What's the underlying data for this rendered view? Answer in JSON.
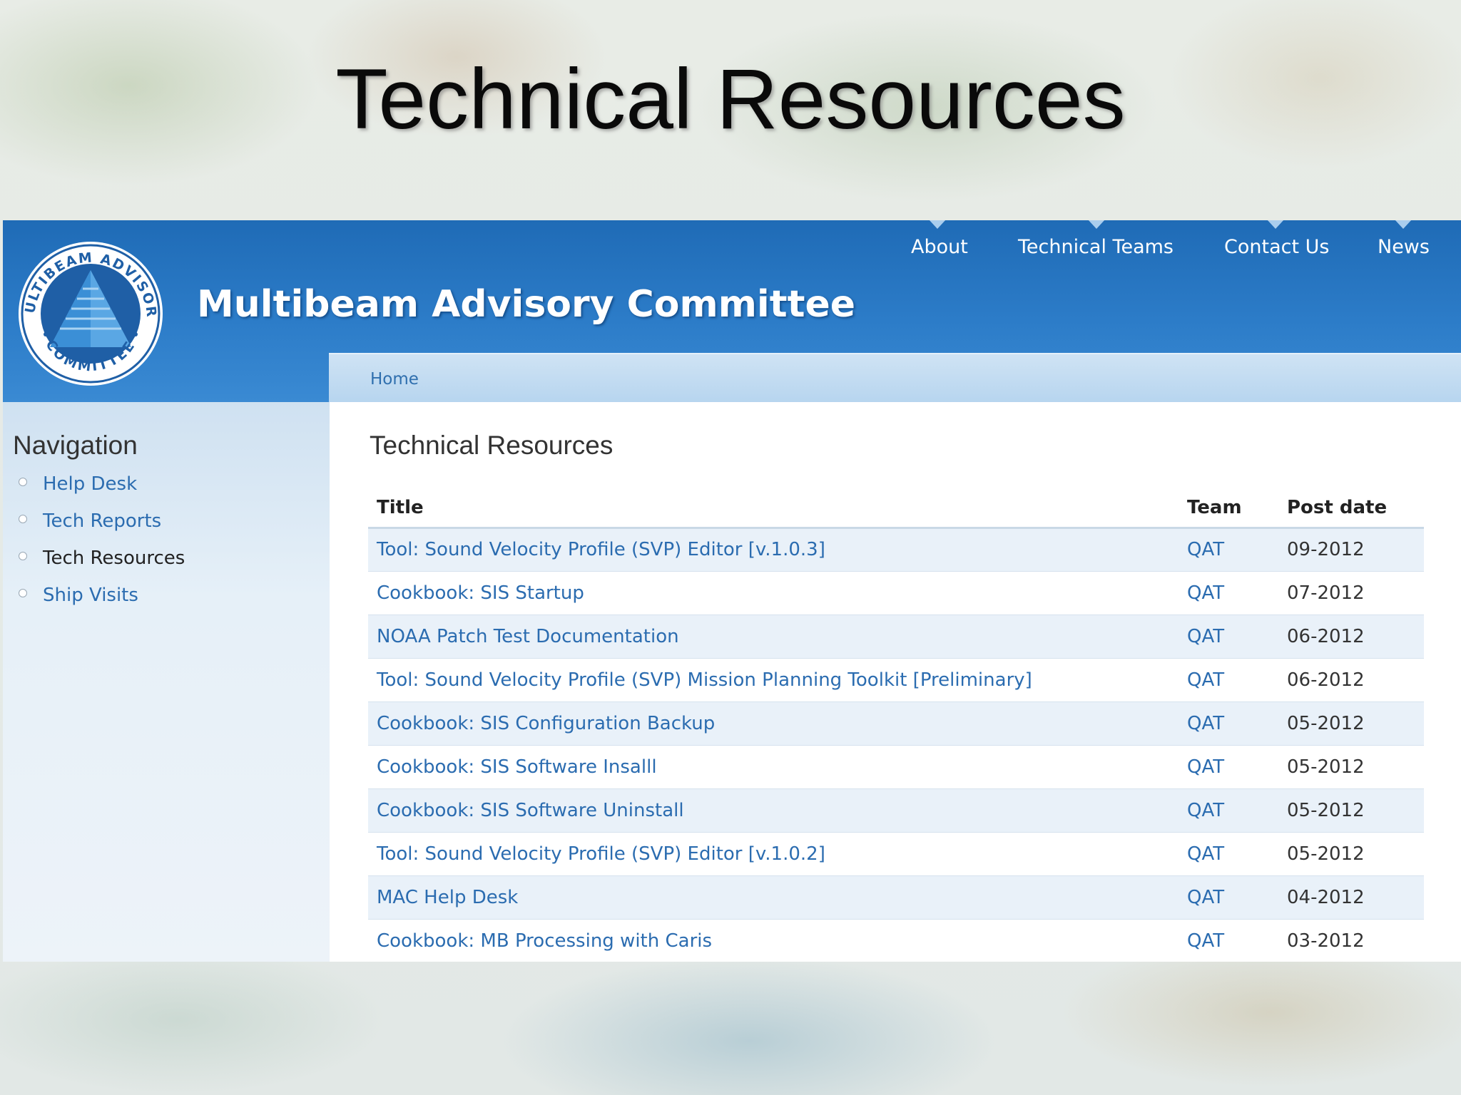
{
  "slide": {
    "title": "Technical Resources"
  },
  "site": {
    "name": "Multibeam Advisory Committee",
    "logo_text": "MULTIBEAM ADVISORY COMMITTEE",
    "top_nav": [
      "About",
      "Technical Teams",
      "Contact Us",
      "News"
    ],
    "breadcrumb": "Home"
  },
  "sidebar": {
    "heading": "Navigation",
    "items": [
      {
        "label": "Help Desk",
        "active": false
      },
      {
        "label": "Tech Reports",
        "active": false
      },
      {
        "label": "Tech Resources",
        "active": true
      },
      {
        "label": "Ship Visits",
        "active": false
      }
    ]
  },
  "main": {
    "title": "Technical Resources",
    "columns": [
      "Title",
      "Team",
      "Post date"
    ],
    "rows": [
      {
        "title": "Tool: Sound Velocity Profile (SVP) Editor [v.1.0.3]",
        "team": "QAT",
        "date": "09-2012"
      },
      {
        "title": "Cookbook: SIS Startup",
        "team": "QAT",
        "date": "07-2012"
      },
      {
        "title": "NOAA Patch Test Documentation",
        "team": "QAT",
        "date": "06-2012"
      },
      {
        "title": "Tool: Sound Velocity Profile (SVP) Mission Planning Toolkit [Preliminary]",
        "team": "QAT",
        "date": "06-2012"
      },
      {
        "title": "Cookbook: SIS Configuration Backup",
        "team": "QAT",
        "date": "05-2012"
      },
      {
        "title": "Cookbook: SIS Software Insalll",
        "team": "QAT",
        "date": "05-2012"
      },
      {
        "title": "Cookbook: SIS Software Uninstall",
        "team": "QAT",
        "date": "05-2012"
      },
      {
        "title": "Tool: Sound Velocity Profile (SVP) Editor [v.1.0.2]",
        "team": "QAT",
        "date": "05-2012"
      },
      {
        "title": "MAC Help Desk",
        "team": "QAT",
        "date": "04-2012"
      },
      {
        "title": "Cookbook: MB Processing with Caris",
        "team": "QAT",
        "date": "03-2012"
      }
    ]
  },
  "colors": {
    "header_blue": "#2c7cc8",
    "link_blue": "#2b6cb0",
    "row_stripe": "#e9f1f9"
  }
}
